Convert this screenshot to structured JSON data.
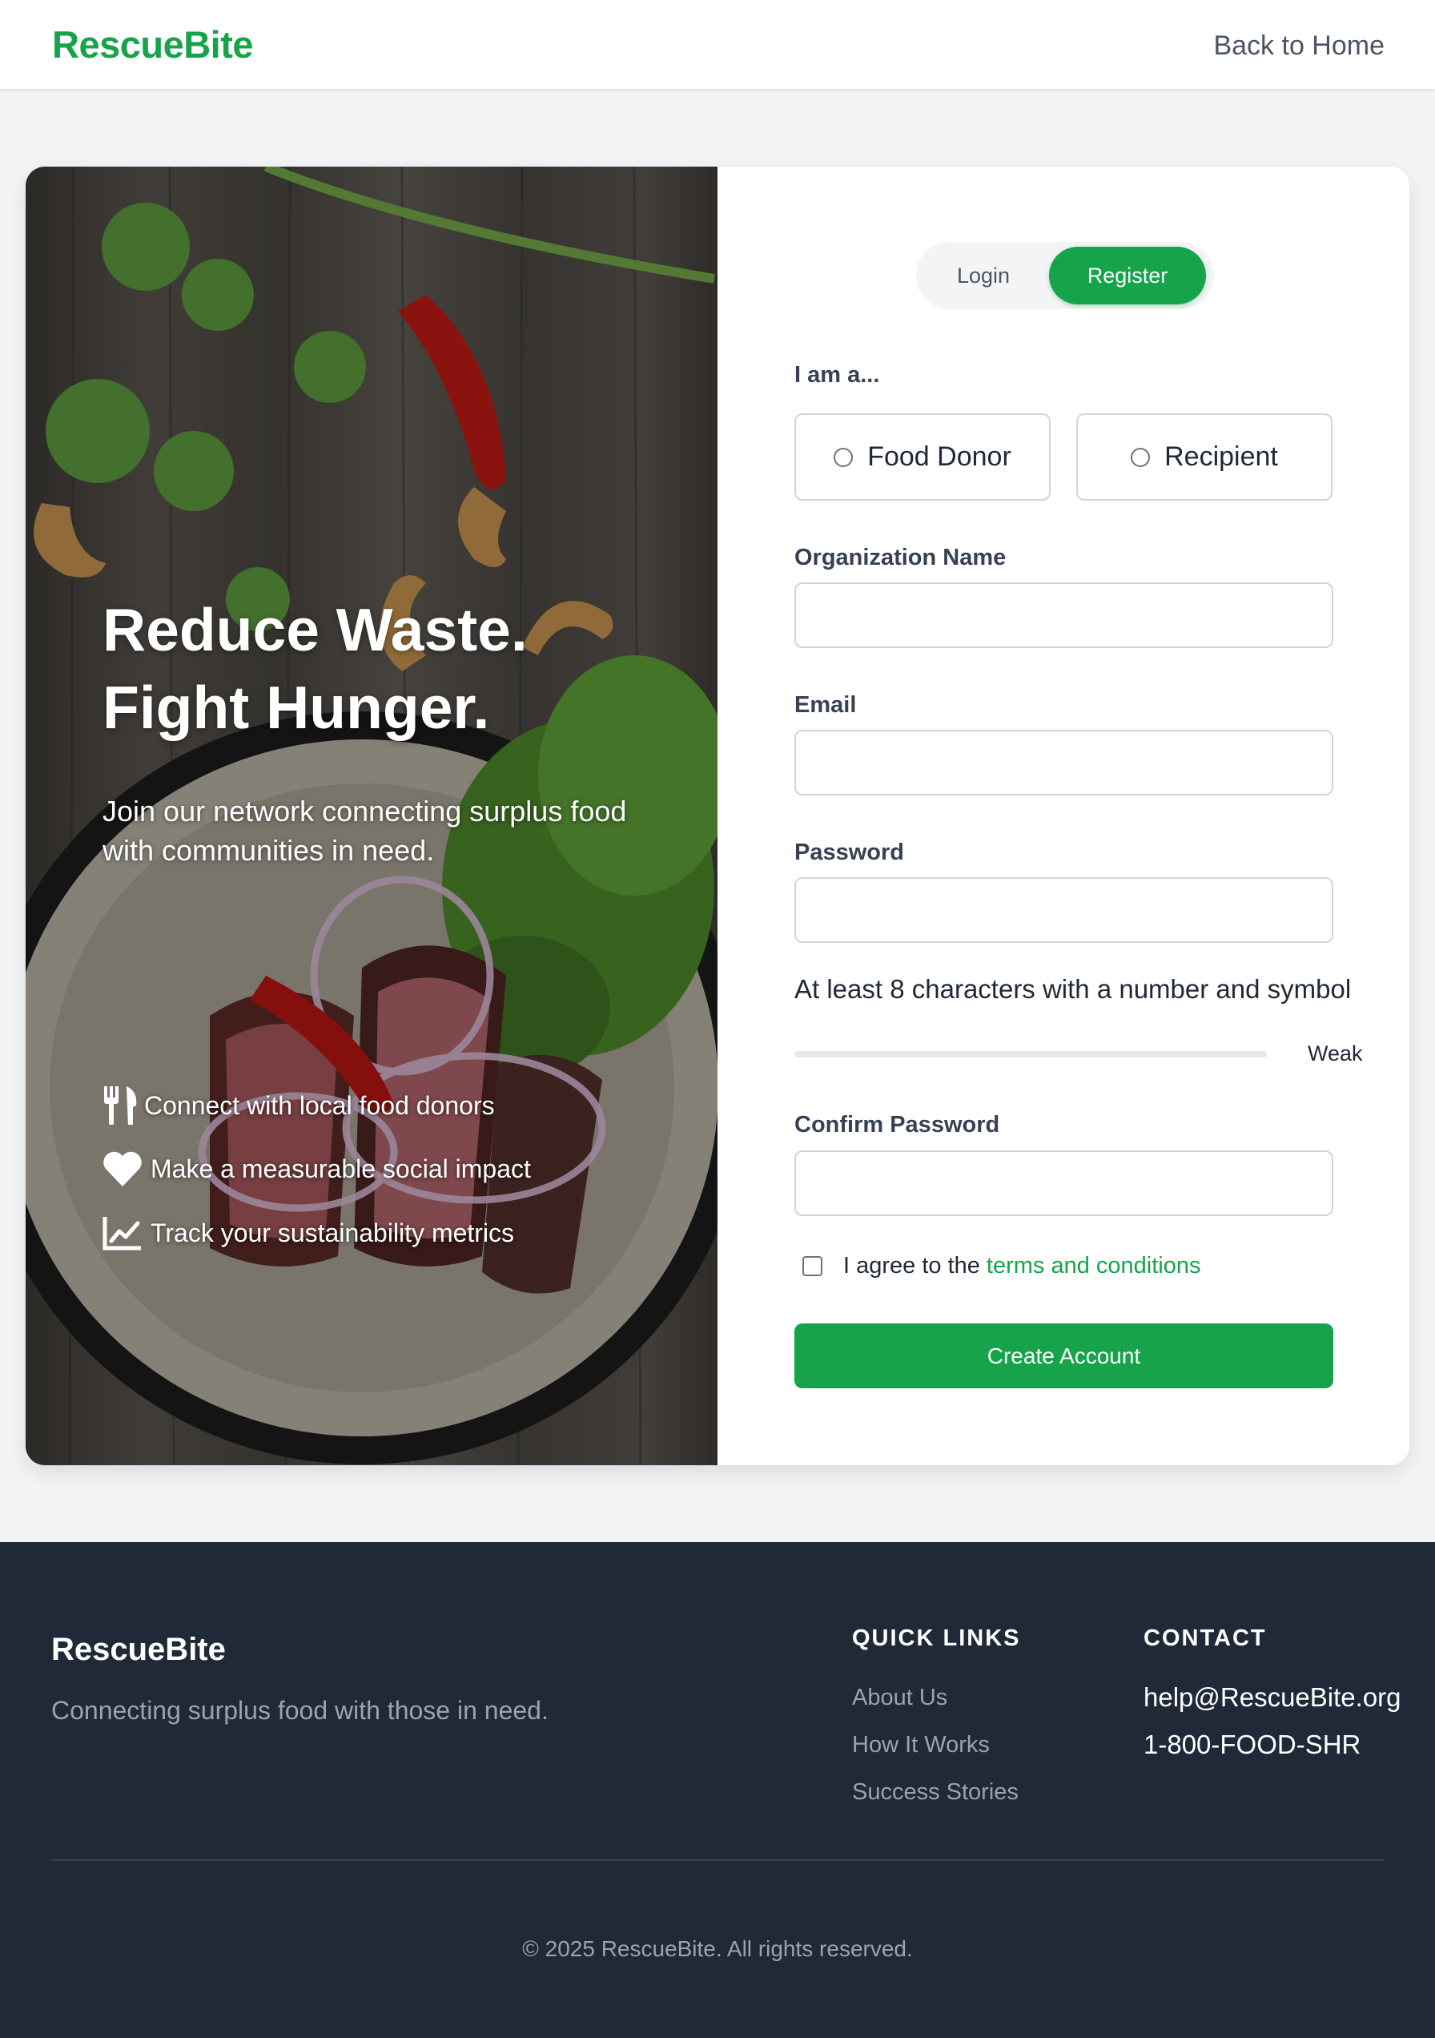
{
  "header": {
    "brand": "RescueBite",
    "back_link": "Back to Home"
  },
  "hero": {
    "title_line1": "Reduce Waste.",
    "title_line2": "Fight Hunger.",
    "subtitle": "Join our network connecting surplus food with communities in need.",
    "features": [
      {
        "icon": "utensils-icon",
        "text": "Connect with local food donors"
      },
      {
        "icon": "heart-icon",
        "text": "Make a measurable social impact"
      },
      {
        "icon": "chart-line-icon",
        "text": "Track your sustainability metrics"
      }
    ]
  },
  "form": {
    "tabs": {
      "login": "Login",
      "register": "Register",
      "active": "register"
    },
    "role_label": "I am a...",
    "roles": [
      "Food Donor",
      "Recipient"
    ],
    "org_label": "Organization Name",
    "org_value": "",
    "email_label": "Email",
    "email_value": "",
    "password_label": "Password",
    "password_value": "",
    "password_hint": "At least 8 characters with a number and symbol",
    "strength": {
      "label": "Weak",
      "level": 0
    },
    "confirm_label": "Confirm Password",
    "confirm_value": "",
    "agree_text": "I agree to the",
    "agree_link": "terms and conditions",
    "submit": "Create Account"
  },
  "footer": {
    "brand": "RescueBite",
    "tagline": "Connecting surplus food with those in need.",
    "quick_links_heading": "QUICK LINKS",
    "quick_links": [
      "About Us",
      "How It Works",
      "Success Stories"
    ],
    "contact_heading": "CONTACT",
    "contact_email": "help@RescueBite.org",
    "contact_phone": "1-800-FOOD-SHR",
    "copyright": "© 2025 RescueBite. All rights reserved."
  },
  "colors": {
    "brand_green": "#16a34a",
    "footer_bg": "#1f2937",
    "page_bg": "#f3f4f6"
  }
}
